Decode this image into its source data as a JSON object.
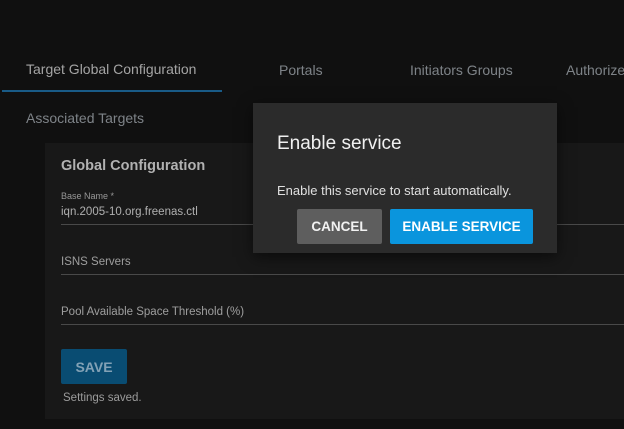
{
  "tabs": [
    {
      "label": "Target Global Configuration",
      "active": true
    },
    {
      "label": "Portals"
    },
    {
      "label": "Initiators Groups"
    },
    {
      "label": "Authorized"
    },
    {
      "label": "Associated Targets"
    }
  ],
  "card": {
    "title": "Global Configuration",
    "base_name": {
      "label": "Base Name *",
      "value": "iqn.2005-10.org.freenas.ctl"
    },
    "isns_servers": {
      "placeholder": "ISNS Servers"
    },
    "pool_threshold": {
      "placeholder": "Pool Available Space Threshold (%)"
    },
    "save_label": "SAVE",
    "status": "Settings saved."
  },
  "dialog": {
    "title": "Enable service",
    "message": "Enable this service to start automatically.",
    "cancel_label": "CANCEL",
    "confirm_label": "ENABLE SERVICE"
  },
  "colors": {
    "background": "#141414",
    "card": "#1e1e1e",
    "dialog": "#2b2b2b",
    "accent": "#0a95dd",
    "save_button": "#0b5d8c",
    "tab_underline": "#1f6fa5"
  }
}
